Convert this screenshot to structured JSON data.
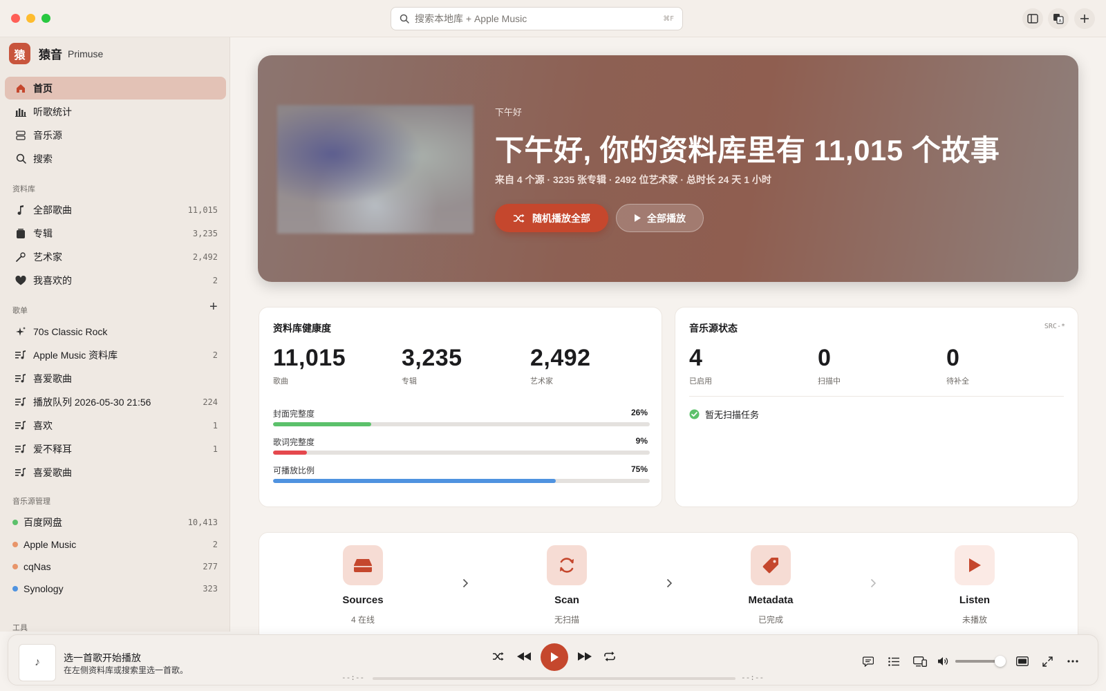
{
  "window": {
    "search_placeholder": "搜索本地库 + Apple Music",
    "search_shortcut": "⌘F"
  },
  "brand": {
    "logo_char": "猿",
    "name": "猿音",
    "sub": "Primuse"
  },
  "sidebar": {
    "nav": [
      {
        "label": "首页",
        "icon": "home-icon",
        "active": true
      },
      {
        "label": "听歌统计",
        "icon": "chart-bar-icon"
      },
      {
        "label": "音乐源",
        "icon": "server-icon"
      },
      {
        "label": "搜索",
        "icon": "search-icon"
      }
    ],
    "library_heading": "资料库",
    "library": [
      {
        "label": "全部歌曲",
        "count": "11,015",
        "icon": "music-note-icon"
      },
      {
        "label": "专辑",
        "count": "3,235",
        "icon": "album-icon"
      },
      {
        "label": "艺术家",
        "count": "2,492",
        "icon": "microphone-icon"
      },
      {
        "label": "我喜欢的",
        "count": "2",
        "icon": "heart-icon"
      }
    ],
    "playlists_heading": "歌单",
    "add_playlist": "+",
    "playlists": [
      {
        "label": "70s Classic Rock",
        "count": "",
        "icon": "sparkles-icon"
      },
      {
        "label": "Apple Music 资料库",
        "count": "2",
        "icon": "playlist-icon"
      },
      {
        "label": "喜爱歌曲",
        "count": "",
        "icon": "playlist-icon"
      },
      {
        "label": "播放队列 2026-05-30 21:56",
        "count": "224",
        "icon": "playlist-icon"
      },
      {
        "label": "喜欢",
        "count": "1",
        "icon": "playlist-icon"
      },
      {
        "label": "爱不释耳",
        "count": "1",
        "icon": "playlist-icon"
      },
      {
        "label": "喜爱歌曲",
        "count": "",
        "icon": "playlist-icon"
      }
    ],
    "sources_heading": "音乐源管理",
    "sources": [
      {
        "label": "百度网盘",
        "count": "10,413",
        "color": "#5cc16b"
      },
      {
        "label": "Apple Music",
        "count": "2",
        "color": "#e8956a"
      },
      {
        "label": "cqNas",
        "count": "277",
        "color": "#e8956a"
      },
      {
        "label": "Synology",
        "count": "323",
        "color": "#4f93e0"
      }
    ],
    "tools_heading": "工具"
  },
  "hero": {
    "greeting": "下午好",
    "title": "下午好, 你的资料库里有 11,015 个故事",
    "subtitle": "来自 4 个源 · 3235 张专辑 · 2492 位艺术家 · 总时长 24 天 1 小时",
    "shuffle_label": "随机播放全部",
    "play_all_label": "全部播放"
  },
  "health": {
    "title": "资料库健康度",
    "stats": [
      {
        "value": "11,015",
        "label": "歌曲"
      },
      {
        "value": "3,235",
        "label": "专辑"
      },
      {
        "value": "2,492",
        "label": "艺术家"
      }
    ],
    "bars": [
      {
        "label": "封面完整度",
        "pct_text": "26%",
        "pct": 26,
        "color": "#5cc16b"
      },
      {
        "label": "歌词完整度",
        "pct_text": "9%",
        "pct": 9,
        "color": "#e5484d"
      },
      {
        "label": "可播放比例",
        "pct_text": "75%",
        "pct": 75,
        "color": "#4f93e0"
      }
    ]
  },
  "sources_status": {
    "title": "音乐源状态",
    "tag": "SRC-*",
    "stats": [
      {
        "value": "4",
        "label": "已启用"
      },
      {
        "value": "0",
        "label": "扫描中"
      },
      {
        "value": "0",
        "label": "待补全"
      }
    ],
    "scan_status": "暂无扫描任务",
    "scan_status_color": "#5cc16b"
  },
  "flow": [
    {
      "name": "Sources",
      "sub": "4 在线",
      "icon": "drive-icon"
    },
    {
      "name": "Scan",
      "sub": "无扫描",
      "icon": "refresh-icon"
    },
    {
      "name": "Metadata",
      "sub": "已完成",
      "icon": "tag-icon"
    },
    {
      "name": "Listen",
      "sub": "未播放",
      "icon": "play-icon"
    }
  ],
  "player": {
    "art_icon": "♪",
    "title": "选一首歌开始播放",
    "subtitle": "在左侧资料库或搜索里选一首歌。",
    "time_elapsed": "--:--",
    "time_remaining": "--:--",
    "volume": 0.93
  },
  "colors": {
    "accent": "#c5472d",
    "sidebar_active": "#e3c2b6"
  }
}
